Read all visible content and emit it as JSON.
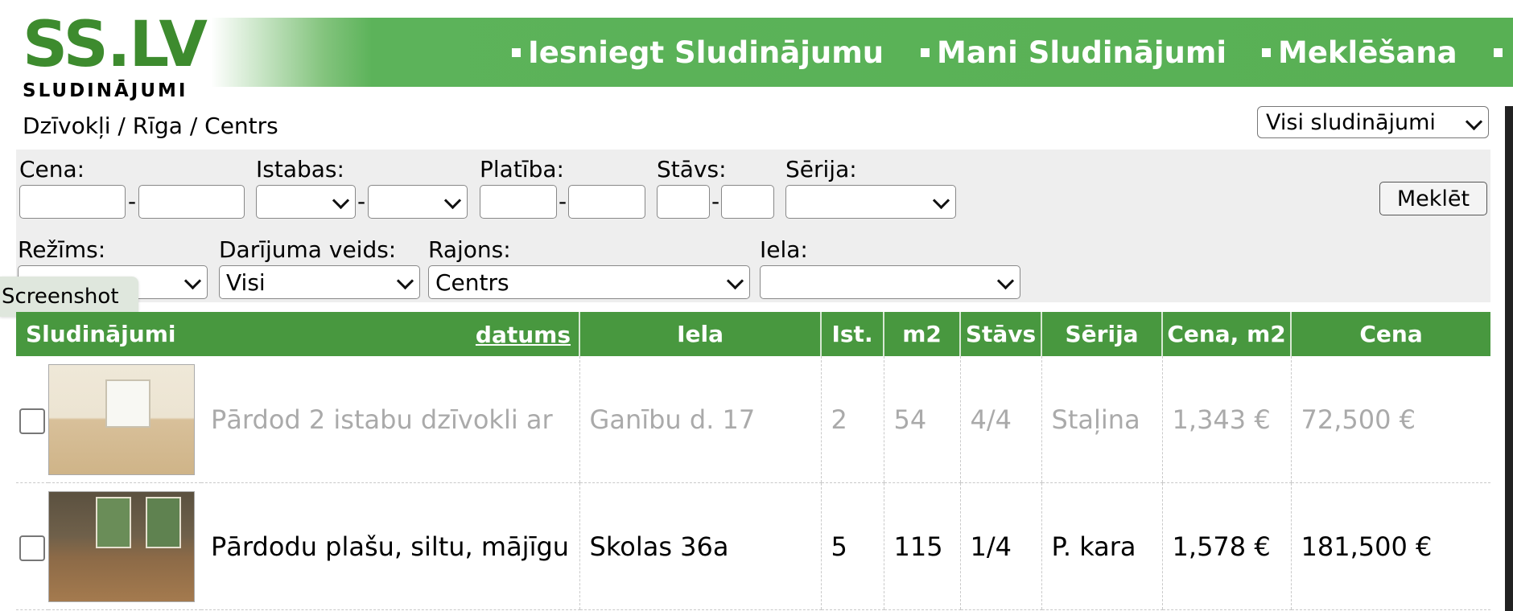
{
  "logo": {
    "brand": "SS.LV",
    "tagline": "SLUDINĀJUMI"
  },
  "nav": [
    {
      "label": "Iesniegt Sludinājumu"
    },
    {
      "label": "Mani Sludinājumi"
    },
    {
      "label": "Meklēšana"
    }
  ],
  "breadcrumb": "Dzīvokļi / Rīga / Centrs",
  "view_select": {
    "value": "Visi sludinājumi"
  },
  "filters": {
    "price_label": "Cena:",
    "rooms_label": "Istabas:",
    "area_label": "Platība:",
    "floor_label": "Stāvs:",
    "series_label": "Sērija:",
    "mode_label": "Režīms:",
    "deal_label": "Darījuma veids:",
    "deal_value": "Visi",
    "district_label": "Rajons:",
    "district_value": "Centrs",
    "street_label": "Iela:",
    "search_button": "Meklēt"
  },
  "tooltip": "Screenshot",
  "table": {
    "headers": {
      "listings": "Sludinājumi",
      "sort": "datums",
      "street": "Iela",
      "rooms": "Ist.",
      "area": "m2",
      "floor": "Stāvs",
      "series": "Sērija",
      "price_m2": "Cena, m2",
      "price": "Cena"
    },
    "rows": [
      {
        "title": "Pārdod 2 istabu dzīvokli ar",
        "street": "Ganību d. 17",
        "rooms": "2",
        "area": "54",
        "floor": "4/4",
        "series": "Staļina",
        "price_m2": "1,343 €",
        "price": "72,500 €"
      },
      {
        "title": "Pārdodu plašu, siltu, mājīgu",
        "street": "Skolas 36a",
        "rooms": "5",
        "area": "115",
        "floor": "1/4",
        "series": "P. kara",
        "price_m2": "1,578 €",
        "price": "181,500 €"
      }
    ]
  },
  "colors": {
    "brand_green": "#3d8b2e",
    "header_green": "#48983f",
    "nav_green": "#5cb35a",
    "faded_text": "#aaaaaa"
  }
}
